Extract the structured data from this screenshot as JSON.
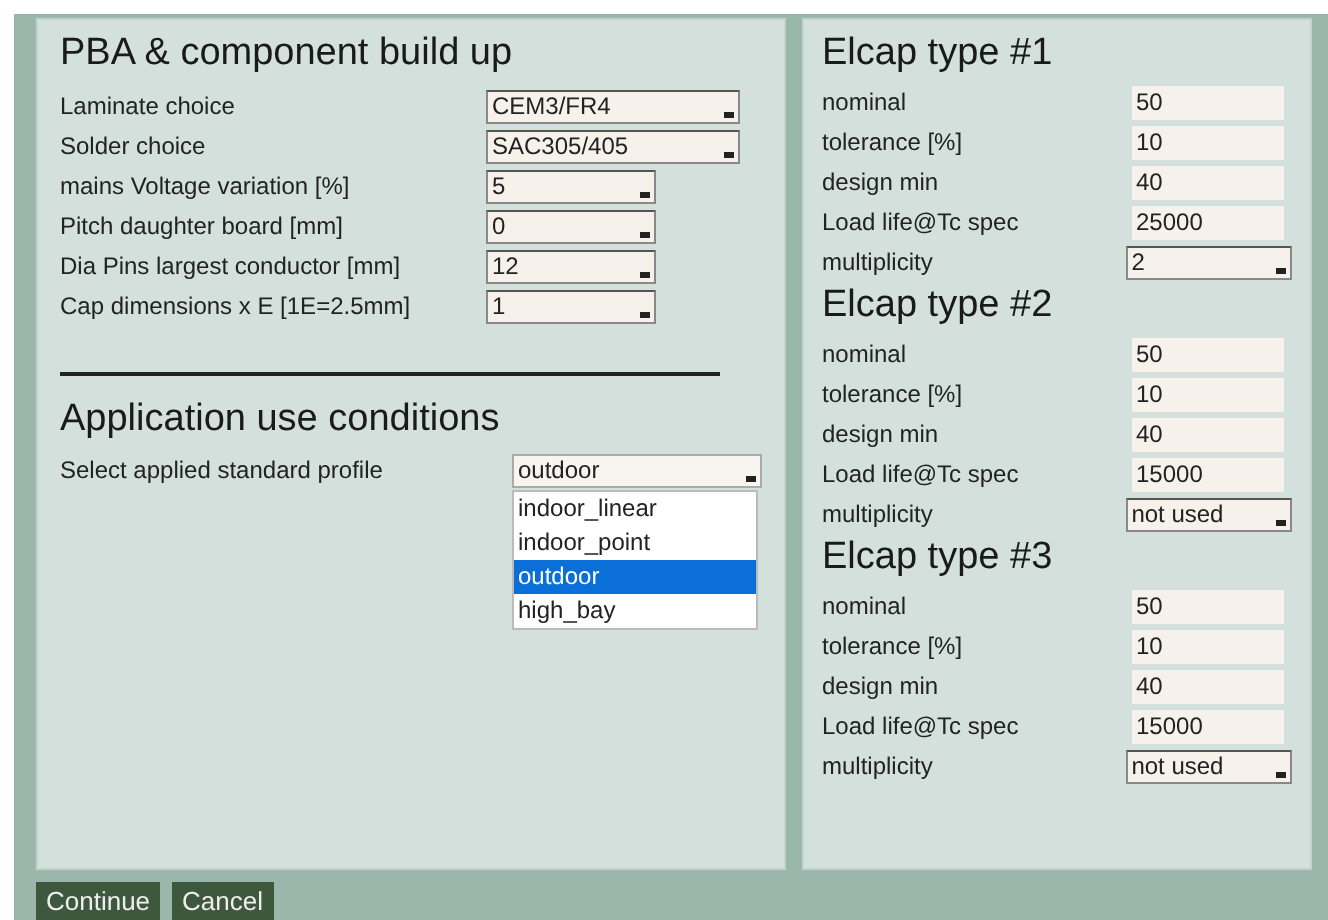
{
  "build_section": {
    "title": "PBA & component build up",
    "fields": [
      {
        "label": "Laminate choice",
        "value": "CEM3/FR4",
        "kind": "wide"
      },
      {
        "label": "Solder choice",
        "value": "SAC305/405",
        "kind": "wide"
      },
      {
        "label": "mains Voltage variation [%]",
        "value": "5",
        "kind": "narrow"
      },
      {
        "label": "Pitch daughter board [mm]",
        "value": "0",
        "kind": "narrow"
      },
      {
        "label": "Dia Pins largest conductor [mm]",
        "value": "12",
        "kind": "narrow"
      },
      {
        "label": "Cap dimensions x E [1E=2.5mm]",
        "value": "1",
        "kind": "narrow"
      }
    ]
  },
  "application_section": {
    "title": "Application use conditions",
    "label": "Select applied standard profile",
    "value": "outdoor",
    "expanded": true,
    "options": [
      {
        "label": "indoor_linear",
        "selected": false
      },
      {
        "label": "indoor_point",
        "selected": false
      },
      {
        "label": "outdoor",
        "selected": true
      },
      {
        "label": "high_bay",
        "selected": false
      }
    ]
  },
  "elcaps": [
    {
      "title": "Elcap type #1",
      "fields": [
        {
          "label": "nominal",
          "value": "50",
          "kind": "input"
        },
        {
          "label": "tolerance [%]",
          "value": "10",
          "kind": "input"
        },
        {
          "label": "design min",
          "value": "40",
          "kind": "input"
        },
        {
          "label": "Load life@Tc spec",
          "value": "25000",
          "kind": "input"
        },
        {
          "label": "multiplicity",
          "value": "2",
          "kind": "select"
        }
      ]
    },
    {
      "title": "Elcap type #2",
      "fields": [
        {
          "label": "nominal",
          "value": "50",
          "kind": "input"
        },
        {
          "label": "tolerance [%]",
          "value": "10",
          "kind": "input"
        },
        {
          "label": "design min",
          "value": "40",
          "kind": "input"
        },
        {
          "label": "Load life@Tc spec",
          "value": "15000",
          "kind": "input"
        },
        {
          "label": "multiplicity",
          "value": "not used",
          "kind": "select"
        }
      ]
    },
    {
      "title": "Elcap type #3",
      "fields": [
        {
          "label": "nominal",
          "value": "50",
          "kind": "input"
        },
        {
          "label": "tolerance [%]",
          "value": "10",
          "kind": "input"
        },
        {
          "label": "design min",
          "value": "40",
          "kind": "input"
        },
        {
          "label": "Load life@Tc spec",
          "value": "15000",
          "kind": "input"
        },
        {
          "label": "multiplicity",
          "value": "not used",
          "kind": "select"
        }
      ]
    }
  ],
  "buttons": [
    "Continue",
    "Cancel"
  ]
}
